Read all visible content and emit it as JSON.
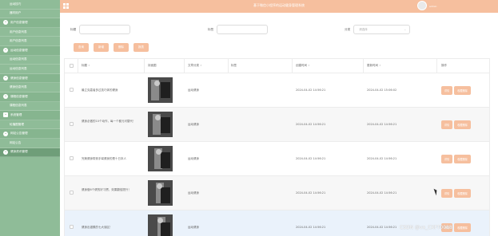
{
  "header": {
    "title": "基于微信小程序的运动健身管理系统",
    "username": "admin"
  },
  "sidebar": {
    "items": [
      {
        "label": "运动技巧",
        "type": "sub"
      },
      {
        "label": "器材用户",
        "type": "sub"
      },
      {
        "label": "用户信息管理",
        "type": "group",
        "icon": "user-icon"
      },
      {
        "label": "用户信息列表",
        "type": "sub"
      },
      {
        "label": "用户信息列表",
        "type": "sub"
      },
      {
        "label": "运动信息管理",
        "type": "group",
        "icon": "sport-icon"
      },
      {
        "label": "运动信息列表",
        "type": "sub"
      },
      {
        "label": "运动信息列表",
        "type": "sub"
      },
      {
        "label": "健身信息管理",
        "type": "group",
        "icon": "fitness-icon"
      },
      {
        "label": "健身信息列表",
        "type": "sub"
      },
      {
        "label": "课程信息管理",
        "type": "group",
        "icon": "course-icon"
      },
      {
        "label": "课程信息列表",
        "type": "sub"
      },
      {
        "label": "系统管理",
        "type": "group",
        "icon": "system-icon"
      },
      {
        "label": "轮播图管理",
        "type": "sub"
      },
      {
        "label": "网站公告管理",
        "type": "group",
        "icon": "notice-icon"
      },
      {
        "label": "网站公告",
        "type": "sub"
      },
      {
        "label": "健身资讯管理",
        "type": "group",
        "icon": "news-icon",
        "active": true
      }
    ]
  },
  "search": {
    "field1_label": "标题",
    "field2_label": "标签",
    "field3_label": "分类",
    "field3_placeholder": "请选择"
  },
  "buttons": {
    "search": "查询",
    "add": "新增",
    "delete": "删除",
    "report": "报表"
  },
  "table": {
    "columns": [
      "标题",
      "封面图",
      "文章分类",
      "标签",
      "创建时间",
      "更新时间",
      "操作"
    ],
    "rows": [
      {
        "title": "最立克嘉者多过技巧体的健身",
        "category": "运动健身",
        "tag": "",
        "created": "2024-04-02 14:56:21",
        "updated": "2024-04-02 15:06:02"
      },
      {
        "title": "健身必做的10个动作，每一个都元可替代！",
        "category": "运动健身",
        "tag": "",
        "created": "2024-04-02 14:56:21",
        "updated": "2024-04-02 14:56:21"
      },
      {
        "title": "完美健身带到手臂健身的是十日本人",
        "category": "运动健身",
        "tag": "",
        "created": "2024-04-02 14:56:21",
        "updated": "2024-04-02 14:56:21"
      },
      {
        "title": "健身做6个健的好习惯，效果翻倍提升！",
        "category": "运动健身",
        "tag": "",
        "created": "2024-04-02 14:56:21",
        "updated": "2024-04-02 14:56:21"
      },
      {
        "title": "健身出错素的七大误区！",
        "category": "运动健身",
        "tag": "",
        "created": "2024-04-02 14:56:21",
        "updated": "2024-04-02 14:56:21"
      }
    ],
    "op_detail": "详情",
    "op_delete": "收藏删除"
  },
  "watermark": "CSDN @vx_CXFT0088",
  "colors": {
    "sidebar": "#8fbc98",
    "header": "#f6bf9e",
    "button": "#f6bf9e"
  }
}
